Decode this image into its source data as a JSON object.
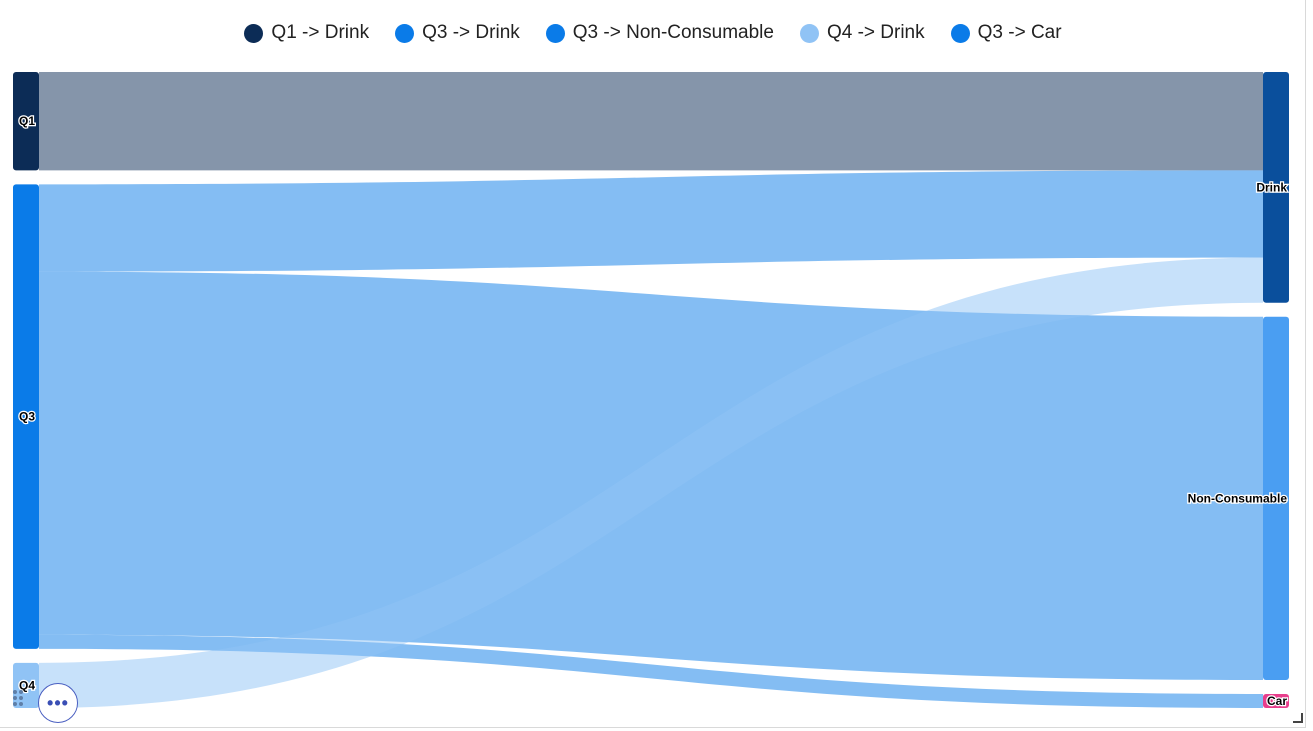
{
  "legend": [
    {
      "label": "Q1 -> Drink",
      "color": "#0c2c56"
    },
    {
      "label": "Q3 -> Drink",
      "color": "#0a7be8"
    },
    {
      "label": "Q3 -> Non-Consumable",
      "color": "#0a7be8"
    },
    {
      "label": "Q4 -> Drink",
      "color": "#90c3f5"
    },
    {
      "label": "Q3 -> Car",
      "color": "#0a7be8"
    }
  ],
  "chart_data": {
    "type": "sankey",
    "nodes": [
      {
        "name": "Q1",
        "side": "source",
        "color": "#0c2c56"
      },
      {
        "name": "Q3",
        "side": "source",
        "color": "#0a7be8"
      },
      {
        "name": "Q4",
        "side": "source",
        "color": "#90c3f5"
      },
      {
        "name": "Drink",
        "side": "target",
        "color": "#0a4f9c"
      },
      {
        "name": "Non-Consumable",
        "side": "target",
        "color": "#4a9ef2"
      },
      {
        "name": "Car",
        "side": "target",
        "color": "#e83e8c"
      }
    ],
    "links": [
      {
        "source": "Q1",
        "target": "Drink",
        "value": 98,
        "color": "#0c2c56",
        "opacity": 0.5
      },
      {
        "source": "Q3",
        "target": "Drink",
        "value": 87,
        "color": "#0a7be8",
        "opacity": 0.5
      },
      {
        "source": "Q3",
        "target": "Non-Consumable",
        "value": 362,
        "color": "#0a7be8",
        "opacity": 0.5
      },
      {
        "source": "Q3",
        "target": "Car",
        "value": 14,
        "color": "#0a7be8",
        "opacity": 0.5
      },
      {
        "source": "Q4",
        "target": "Drink",
        "value": 45,
        "color": "#90c3f5",
        "opacity": 0.5
      }
    ]
  },
  "controls": {
    "more_label": "•••"
  }
}
